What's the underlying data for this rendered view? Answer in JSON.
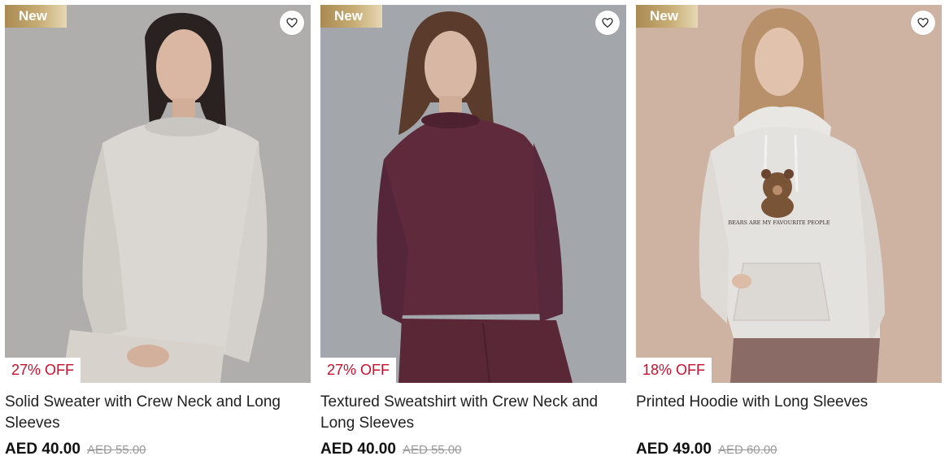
{
  "products": [
    {
      "badge": "New",
      "wishlist_icon": "heart-outline-icon",
      "discount": "27% OFF",
      "title": "Solid Sweater with Crew Neck and Long Sleeves",
      "price": "AED 40.00",
      "old_price": "AED 55.00"
    },
    {
      "badge": "New",
      "wishlist_icon": "heart-outline-icon",
      "discount": "27% OFF",
      "title": "Textured Sweatshirt with Crew Neck and Long Sleeves",
      "price": "AED 40.00",
      "old_price": "AED 55.00"
    },
    {
      "badge": "New",
      "wishlist_icon": "heart-outline-icon",
      "discount": "18% OFF",
      "title": "Printed Hoodie with Long Sleeves",
      "price": "AED 49.00",
      "old_price": "AED 60.00",
      "print_text": "BEARS ARE MY FAVOURITE PEOPLE"
    }
  ],
  "colors": {
    "discount_red": "#c8102e",
    "badge_gold": "#b8995e",
    "sweater_grey": "#d9d6d1",
    "sweater_plum": "#5e2a3c",
    "hoodie_grey": "#e4e2df"
  }
}
